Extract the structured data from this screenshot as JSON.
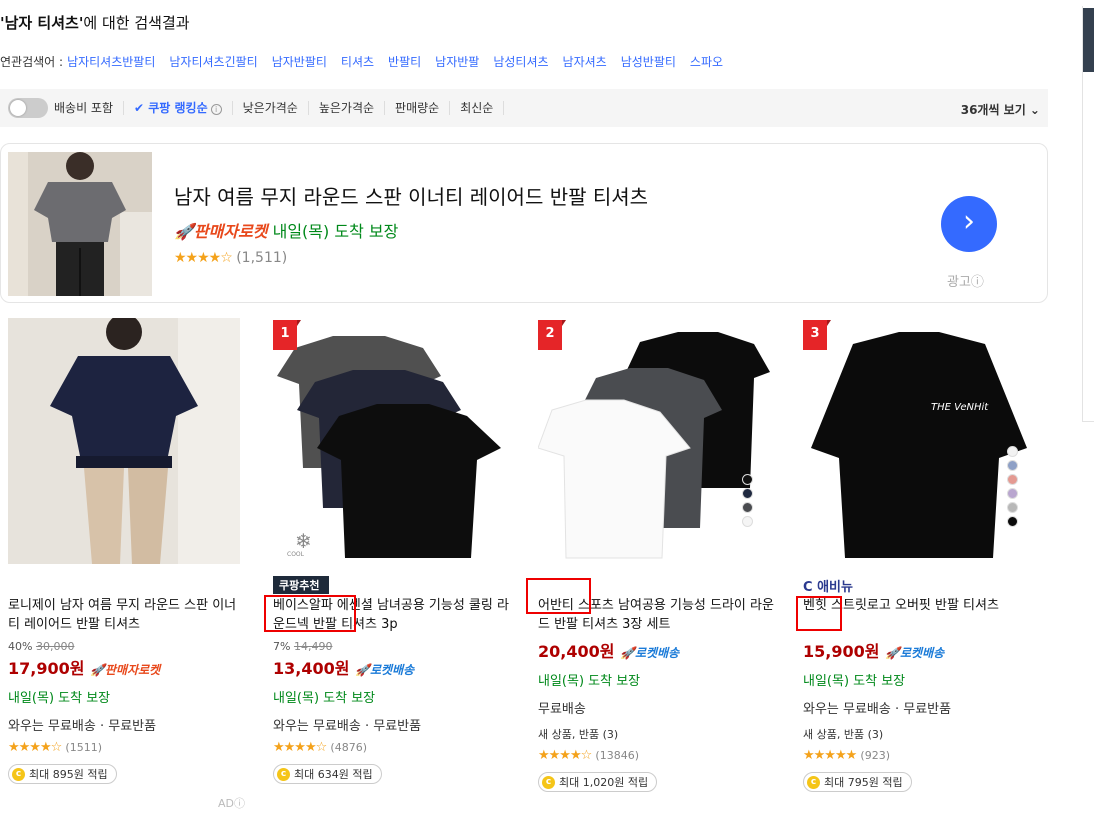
{
  "search": {
    "query": "'남자 티셔츠'",
    "suffix": "에 대한 검색결과"
  },
  "related": {
    "label": "연관검색어 :",
    "keywords": [
      "남자티셔츠반팔티",
      "남자티셔츠긴팔티",
      "남자반팔티",
      "티셔츠",
      "반팔티",
      "남자반팔",
      "남성티셔츠",
      "남자셔츠",
      "남성반팔티",
      "스파오"
    ]
  },
  "sortbar": {
    "shipping_label": "배송비 포함",
    "ranking": "✔ 쿠팡 랭킹순",
    "info": "i",
    "options": [
      "낮은가격순",
      "높은가격순",
      "판매량순",
      "최신순"
    ],
    "per_page": "36개씩 보기 ⌄"
  },
  "ad": {
    "title": "남자 여름 무지 라운드 스판 이너티 레이어드 반팔 티셔츠",
    "seller_rocket": "🚀판매자로켓",
    "delivery": " 내일(목) 도착 보장",
    "stars": "★★★★☆",
    "count": "(1,511)",
    "arrow": "›",
    "label": "광고ⓘ"
  },
  "products": [
    {
      "tag": "",
      "name": "로니제이 남자 여름 무지 라운드 스판 이너티 레이어드 반팔 티셔츠",
      "discount": "40%",
      "orig_price": "30,000",
      "price": "17,900원",
      "rocket": "🚀판매자로켓",
      "arrive": "내일(목) 도착 보장",
      "benefit": "와우는 무료배송 · 무료반품",
      "new_product": "",
      "stars": "★★★★☆",
      "count": "(1511)",
      "point": "최대 895원 적립"
    },
    {
      "rank": "1",
      "tag": "쿠팡추천",
      "name": "베이스알파 에센셜 남녀공용 기능성 쿨링 라운드넥 반팔 티셔츠 3p",
      "discount": "7%",
      "orig_price": "14,490",
      "price": "13,400원",
      "rocket": "🚀로켓배송",
      "arrive": "내일(목) 도착 보장",
      "benefit": "와우는 무료배송 · 무료반품",
      "new_product": "",
      "stars": "★★★★☆",
      "count": "(4876)",
      "point": "최대 634원 적립",
      "cool_label": "COOL"
    },
    {
      "rank": "2",
      "tag": "",
      "name": "어반티 스포츠 남여공용 기능성 드라이 라운드 반팔 티셔츠 3장 세트",
      "discount": "",
      "orig_price": "",
      "price": "20,400원",
      "rocket": "🚀로켓배송",
      "arrive": "내일(목) 도착 보장",
      "benefit": "무료배송",
      "new_product": "새 상품, 반품 (3)",
      "stars": "★★★★☆",
      "count": "(13846)",
      "point": "최대 1,020원 적립"
    },
    {
      "rank": "3",
      "tag": "C 애비뉴",
      "name": "벤힛 스트릿로고 오버핏 반팔 티셔츠",
      "discount": "",
      "orig_price": "",
      "price": "15,900원",
      "rocket": "🚀로켓배송",
      "arrive": "내일(목) 도착 보장",
      "benefit": "와우는 무료배송 · 무료반품",
      "new_product": "새 상품, 반품 (3)",
      "stars": "★★★★★",
      "count": "(923)",
      "point": "최대 795원 적립",
      "print_text": "THE VeNHit"
    }
  ],
  "ad_mark": "ADⓘ",
  "colors": {
    "accent": "#346aff",
    "price": "#ae0000",
    "green": "#00891a",
    "badge": "#e52528"
  }
}
